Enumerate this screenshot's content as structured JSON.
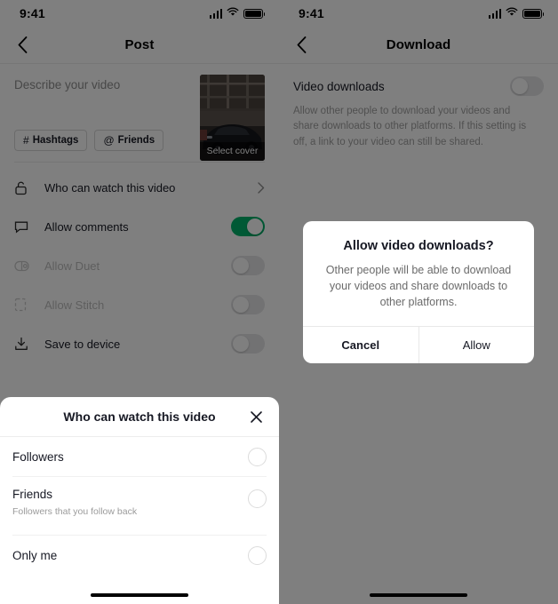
{
  "left_panel": {
    "status": {
      "time": "9:41",
      "signal_icon": "signal-bars-icon",
      "wifi_icon": "wifi-icon",
      "battery_icon": "battery-full-icon"
    },
    "nav": {
      "back_icon": "chevron-left-icon",
      "title": "Post"
    },
    "compose": {
      "placeholder": "Describe your video",
      "chips": [
        {
          "symbol": "#",
          "label": "Hashtags",
          "icon": "hashtag-icon"
        },
        {
          "symbol": "@",
          "label": "Friends",
          "icon": "at-mention-icon"
        }
      ],
      "cover": {
        "label": "Select cover",
        "alt": "black sports car in parking garage"
      }
    },
    "settings": [
      {
        "icon": "unlock-icon",
        "label": "Who can watch this video",
        "control": "chevron",
        "disabled": false
      },
      {
        "icon": "comment-bubble-icon",
        "label": "Allow comments",
        "control": "toggle",
        "toggle_on": true,
        "disabled": false
      },
      {
        "icon": "duet-icon",
        "label": "Allow Duet",
        "control": "toggle",
        "toggle_on": false,
        "disabled": true
      },
      {
        "icon": "stitch-icon",
        "label": "Allow Stitch",
        "control": "toggle",
        "toggle_on": false,
        "disabled": true
      },
      {
        "icon": "download-icon",
        "label": "Save to device",
        "control": "toggle",
        "toggle_on": false,
        "disabled": false
      }
    ],
    "sheet": {
      "title": "Who can watch this video",
      "close_icon": "close-icon",
      "options": [
        {
          "label": "Followers",
          "subtitle": "",
          "selected": false
        },
        {
          "label": "Friends",
          "subtitle": "Followers that you follow back",
          "selected": false
        },
        {
          "label": "Only me",
          "subtitle": "",
          "selected": false
        }
      ]
    }
  },
  "right_panel": {
    "status": {
      "time": "9:41",
      "signal_icon": "signal-bars-icon",
      "wifi_icon": "wifi-icon",
      "battery_icon": "battery-full-icon"
    },
    "nav": {
      "back_icon": "chevron-left-icon",
      "title": "Download"
    },
    "download": {
      "title": "Video downloads",
      "toggle_on": false,
      "description": "Allow other people to download your videos and share downloads to other platforms. If this setting is off, a link to your video can still be shared."
    },
    "alert": {
      "title": "Allow video downloads?",
      "message": "Other people will be able to download your videos and share downloads to other platforms.",
      "cancel_label": "Cancel",
      "confirm_label": "Allow"
    }
  },
  "colors": {
    "accent_green": "#00b26a",
    "text_primary": "#161823",
    "text_muted": "#9b9b9b",
    "dim_overlay": "#808080",
    "toggle_off": "#e4e4e6"
  }
}
